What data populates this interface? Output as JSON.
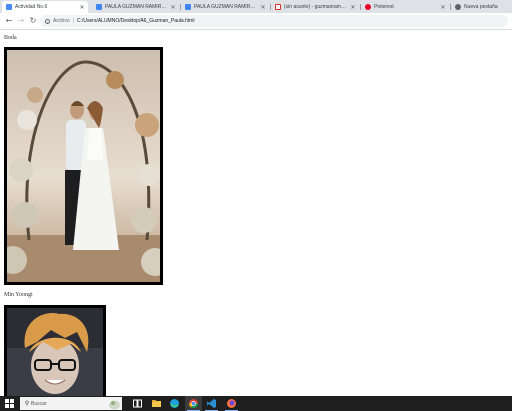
{
  "browser": {
    "tabs": [
      {
        "title": "Actividad No.6",
        "active": true,
        "favicon_color": "#4a8af4"
      },
      {
        "title": "PAULA GUZMAN RAMIREZ - A",
        "active": false,
        "favicon_color": "#4285f4"
      },
      {
        "title": "PAULA GUZMAN RAMIREZ - A",
        "active": false,
        "favicon_color": "#4285f4"
      },
      {
        "title": "(sin asunto) - guzmanramirez",
        "active": false,
        "favicon_color": "#d93025"
      },
      {
        "title": "Pinterest",
        "active": false,
        "favicon_color": "#e60023"
      },
      {
        "title": "Nueva pestaña",
        "active": false,
        "favicon_color": "#5f6368"
      }
    ],
    "address": {
      "scheme_label": "Archivo",
      "url": "C:/Users/ALUMNO/Desktop/A6_Guzman_Paula.html"
    }
  },
  "page": {
    "sections": [
      {
        "caption": "Boda",
        "image_alt": "Wedding couple under floral arch"
      },
      {
        "caption": "Min Yoongi",
        "image_alt": "Portrait with glasses and orange hair"
      }
    ]
  },
  "taskbar": {
    "search_placeholder": "Buscar",
    "apps": [
      "task-view",
      "file-explorer",
      "edge",
      "chrome",
      "vscode",
      "firefox"
    ]
  }
}
